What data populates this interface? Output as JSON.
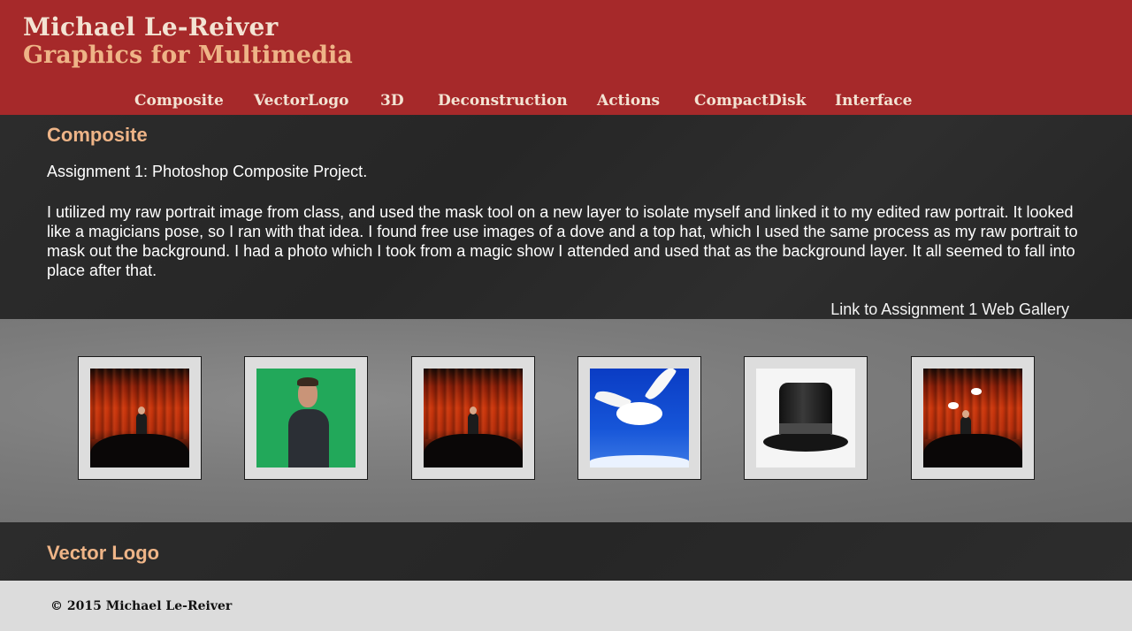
{
  "header": {
    "name": "Michael Le-Reiver",
    "subtitle": "Graphics for Multimedia",
    "nav": [
      "Composite",
      "VectorLogo",
      "3D",
      "Deconstruction",
      "Actions",
      "CompactDisk",
      "Interface"
    ]
  },
  "composite": {
    "title": "Composite",
    "intro": "Assignment 1: Photoshop Composite Project.",
    "description": "I utilized my raw portrait image from class, and used the mask tool on a new layer to isolate myself and linked it to my edited raw portrait. It looked like a magicians pose, so I ran with that idea. I found free use images of a dove and a top hat, which I used the same process as my raw portrait to mask out the background. I had a photo which I took from a magic show I attended and used that as the background layer. It all seemed to fall into place after that.",
    "link": "Link to Assignment 1 Web Gallery",
    "thumbnails": [
      "magic-show-stage",
      "green-screen-portrait",
      "magic-show-stage",
      "white-dove",
      "top-hat",
      "final-composite"
    ]
  },
  "vector_logo": {
    "title": "Vector Logo"
  },
  "footer": {
    "copyright": "© 2015 Michael Le-Reiver"
  },
  "colors": {
    "header_bg": "#a6292a",
    "accent": "#eeb487",
    "dark_section": "#2a2a2a",
    "gallery_bg": "#7b7b7b",
    "footer_bg": "#dcdcdc"
  }
}
